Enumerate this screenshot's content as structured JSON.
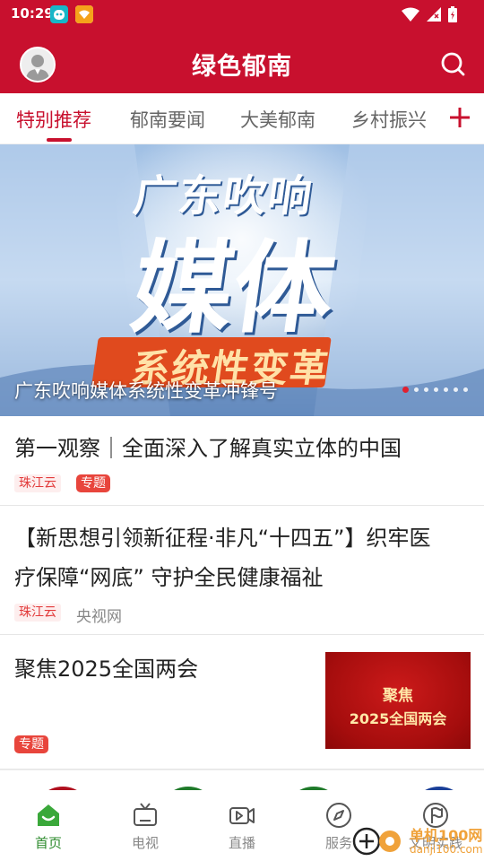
{
  "status_bar": {
    "time": "10:29"
  },
  "header": {
    "title": "绿色郁南"
  },
  "tabs": [
    {
      "label": "特别推荐"
    },
    {
      "label": "郁南要闻"
    },
    {
      "label": "大美郁南"
    },
    {
      "label": "乡村振兴"
    }
  ],
  "banner": {
    "title_line1": "广东吹响",
    "title_line2": "媒体",
    "title_line3": "系统性变革",
    "caption": "广东吹响媒体系统性变革冲锋号",
    "slide_count": 7,
    "active_slide": 1
  },
  "news": [
    {
      "headline": "第一观察｜全面深入了解真实立体的中国",
      "tags": [
        "珠江云",
        "专题"
      ]
    },
    {
      "headline_line1": "【新思想引领新征程·非凡“十四五”】织牢医",
      "headline_line2": "疗保障“网底” 守护全民健康福祉",
      "tag": "珠江云",
      "source": "央视网"
    },
    {
      "headline": "聚焦2025全国两会",
      "tag": "专题",
      "thumb_line1": "聚焦",
      "thumb_line2": "2025全国两会"
    }
  ],
  "bottom_nav": [
    {
      "label": "首页"
    },
    {
      "label": "电视"
    },
    {
      "label": "直播"
    },
    {
      "label": "服务"
    },
    {
      "label": "文明实践"
    }
  ],
  "watermark": {
    "line1": "单机100网",
    "line2": "danji100.com"
  },
  "colors": {
    "brand_red": "#c8102e",
    "nav_active_green": "#2e8b2e",
    "tag_red": "#e8453c"
  }
}
